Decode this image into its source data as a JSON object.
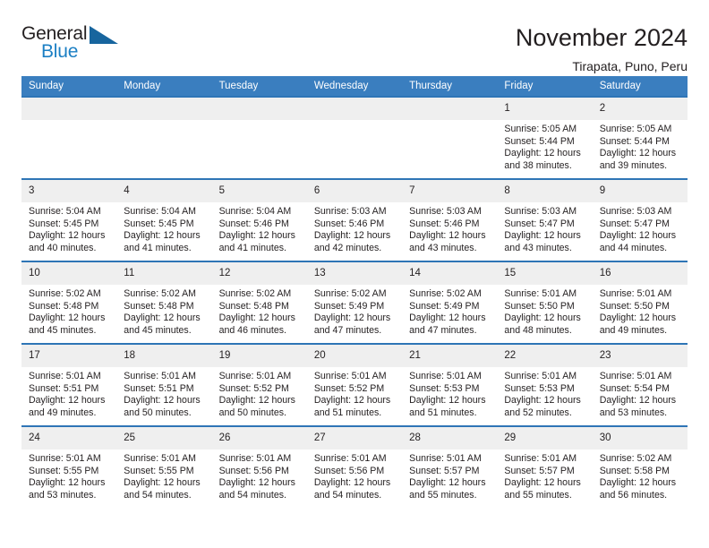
{
  "brand": {
    "name_top": "General",
    "name_bottom": "Blue",
    "triangle_color": "#17659e",
    "blue_color": "#1b7fc4"
  },
  "header": {
    "title": "November 2024",
    "subtitle": "Tirapata, Puno, Peru",
    "header_bg": "#3a7ebf",
    "row_divider": "#2e75b6",
    "daynum_bg": "#efefef"
  },
  "weekdays": [
    "Sunday",
    "Monday",
    "Tuesday",
    "Wednesday",
    "Thursday",
    "Friday",
    "Saturday"
  ],
  "labels": {
    "sunrise": "Sunrise:",
    "sunset": "Sunset:",
    "daylight": "Daylight:"
  },
  "weeks": [
    [
      {
        "day": "",
        "sunrise": "",
        "sunset": "",
        "daylight": ""
      },
      {
        "day": "",
        "sunrise": "",
        "sunset": "",
        "daylight": ""
      },
      {
        "day": "",
        "sunrise": "",
        "sunset": "",
        "daylight": ""
      },
      {
        "day": "",
        "sunrise": "",
        "sunset": "",
        "daylight": ""
      },
      {
        "day": "",
        "sunrise": "",
        "sunset": "",
        "daylight": ""
      },
      {
        "day": "1",
        "sunrise": "Sunrise: 5:05 AM",
        "sunset": "Sunset: 5:44 PM",
        "daylight": "Daylight: 12 hours and 38 minutes."
      },
      {
        "day": "2",
        "sunrise": "Sunrise: 5:05 AM",
        "sunset": "Sunset: 5:44 PM",
        "daylight": "Daylight: 12 hours and 39 minutes."
      }
    ],
    [
      {
        "day": "3",
        "sunrise": "Sunrise: 5:04 AM",
        "sunset": "Sunset: 5:45 PM",
        "daylight": "Daylight: 12 hours and 40 minutes."
      },
      {
        "day": "4",
        "sunrise": "Sunrise: 5:04 AM",
        "sunset": "Sunset: 5:45 PM",
        "daylight": "Daylight: 12 hours and 41 minutes."
      },
      {
        "day": "5",
        "sunrise": "Sunrise: 5:04 AM",
        "sunset": "Sunset: 5:46 PM",
        "daylight": "Daylight: 12 hours and 41 minutes."
      },
      {
        "day": "6",
        "sunrise": "Sunrise: 5:03 AM",
        "sunset": "Sunset: 5:46 PM",
        "daylight": "Daylight: 12 hours and 42 minutes."
      },
      {
        "day": "7",
        "sunrise": "Sunrise: 5:03 AM",
        "sunset": "Sunset: 5:46 PM",
        "daylight": "Daylight: 12 hours and 43 minutes."
      },
      {
        "day": "8",
        "sunrise": "Sunrise: 5:03 AM",
        "sunset": "Sunset: 5:47 PM",
        "daylight": "Daylight: 12 hours and 43 minutes."
      },
      {
        "day": "9",
        "sunrise": "Sunrise: 5:03 AM",
        "sunset": "Sunset: 5:47 PM",
        "daylight": "Daylight: 12 hours and 44 minutes."
      }
    ],
    [
      {
        "day": "10",
        "sunrise": "Sunrise: 5:02 AM",
        "sunset": "Sunset: 5:48 PM",
        "daylight": "Daylight: 12 hours and 45 minutes."
      },
      {
        "day": "11",
        "sunrise": "Sunrise: 5:02 AM",
        "sunset": "Sunset: 5:48 PM",
        "daylight": "Daylight: 12 hours and 45 minutes."
      },
      {
        "day": "12",
        "sunrise": "Sunrise: 5:02 AM",
        "sunset": "Sunset: 5:48 PM",
        "daylight": "Daylight: 12 hours and 46 minutes."
      },
      {
        "day": "13",
        "sunrise": "Sunrise: 5:02 AM",
        "sunset": "Sunset: 5:49 PM",
        "daylight": "Daylight: 12 hours and 47 minutes."
      },
      {
        "day": "14",
        "sunrise": "Sunrise: 5:02 AM",
        "sunset": "Sunset: 5:49 PM",
        "daylight": "Daylight: 12 hours and 47 minutes."
      },
      {
        "day": "15",
        "sunrise": "Sunrise: 5:01 AM",
        "sunset": "Sunset: 5:50 PM",
        "daylight": "Daylight: 12 hours and 48 minutes."
      },
      {
        "day": "16",
        "sunrise": "Sunrise: 5:01 AM",
        "sunset": "Sunset: 5:50 PM",
        "daylight": "Daylight: 12 hours and 49 minutes."
      }
    ],
    [
      {
        "day": "17",
        "sunrise": "Sunrise: 5:01 AM",
        "sunset": "Sunset: 5:51 PM",
        "daylight": "Daylight: 12 hours and 49 minutes."
      },
      {
        "day": "18",
        "sunrise": "Sunrise: 5:01 AM",
        "sunset": "Sunset: 5:51 PM",
        "daylight": "Daylight: 12 hours and 50 minutes."
      },
      {
        "day": "19",
        "sunrise": "Sunrise: 5:01 AM",
        "sunset": "Sunset: 5:52 PM",
        "daylight": "Daylight: 12 hours and 50 minutes."
      },
      {
        "day": "20",
        "sunrise": "Sunrise: 5:01 AM",
        "sunset": "Sunset: 5:52 PM",
        "daylight": "Daylight: 12 hours and 51 minutes."
      },
      {
        "day": "21",
        "sunrise": "Sunrise: 5:01 AM",
        "sunset": "Sunset: 5:53 PM",
        "daylight": "Daylight: 12 hours and 51 minutes."
      },
      {
        "day": "22",
        "sunrise": "Sunrise: 5:01 AM",
        "sunset": "Sunset: 5:53 PM",
        "daylight": "Daylight: 12 hours and 52 minutes."
      },
      {
        "day": "23",
        "sunrise": "Sunrise: 5:01 AM",
        "sunset": "Sunset: 5:54 PM",
        "daylight": "Daylight: 12 hours and 53 minutes."
      }
    ],
    [
      {
        "day": "24",
        "sunrise": "Sunrise: 5:01 AM",
        "sunset": "Sunset: 5:55 PM",
        "daylight": "Daylight: 12 hours and 53 minutes."
      },
      {
        "day": "25",
        "sunrise": "Sunrise: 5:01 AM",
        "sunset": "Sunset: 5:55 PM",
        "daylight": "Daylight: 12 hours and 54 minutes."
      },
      {
        "day": "26",
        "sunrise": "Sunrise: 5:01 AM",
        "sunset": "Sunset: 5:56 PM",
        "daylight": "Daylight: 12 hours and 54 minutes."
      },
      {
        "day": "27",
        "sunrise": "Sunrise: 5:01 AM",
        "sunset": "Sunset: 5:56 PM",
        "daylight": "Daylight: 12 hours and 54 minutes."
      },
      {
        "day": "28",
        "sunrise": "Sunrise: 5:01 AM",
        "sunset": "Sunset: 5:57 PM",
        "daylight": "Daylight: 12 hours and 55 minutes."
      },
      {
        "day": "29",
        "sunrise": "Sunrise: 5:01 AM",
        "sunset": "Sunset: 5:57 PM",
        "daylight": "Daylight: 12 hours and 55 minutes."
      },
      {
        "day": "30",
        "sunrise": "Sunrise: 5:02 AM",
        "sunset": "Sunset: 5:58 PM",
        "daylight": "Daylight: 12 hours and 56 minutes."
      }
    ]
  ]
}
